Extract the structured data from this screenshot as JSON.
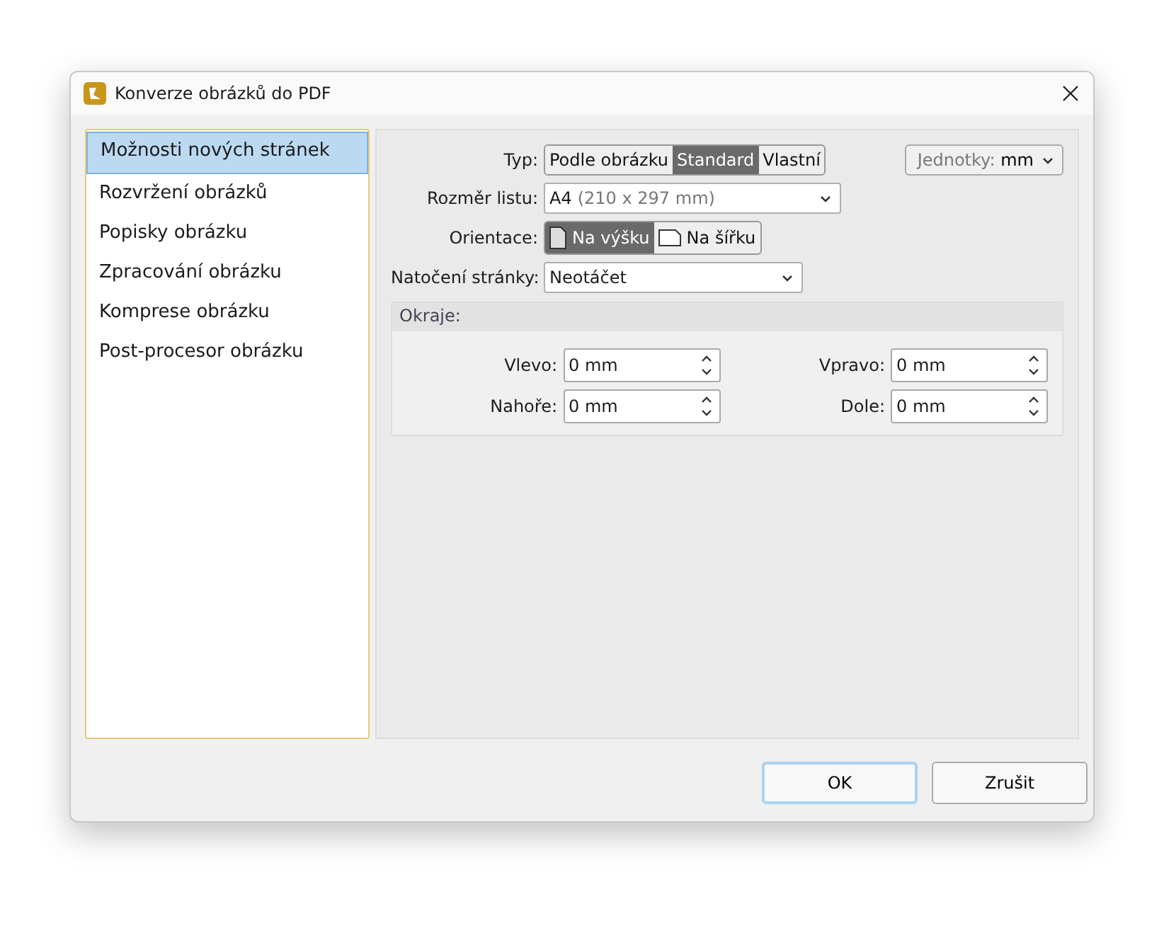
{
  "window": {
    "title": "Konverze obrázků do PDF"
  },
  "sidebar": {
    "items": [
      {
        "label": "Možnosti nových stránek",
        "selected": true
      },
      {
        "label": "Rozvržení obrázků",
        "selected": false
      },
      {
        "label": "Popisky obrázku",
        "selected": false
      },
      {
        "label": "Zpracování obrázku",
        "selected": false
      },
      {
        "label": "Komprese obrázku",
        "selected": false
      },
      {
        "label": "Post-procesor obrázku",
        "selected": false
      }
    ]
  },
  "form": {
    "type": {
      "label": "Typ:",
      "options": [
        {
          "label": "Podle obrázku",
          "selected": false
        },
        {
          "label": "Standard",
          "selected": true
        },
        {
          "label": "Vlastní",
          "selected": false
        }
      ]
    },
    "units": {
      "label": "Jednotky:",
      "value": "mm"
    },
    "sheet_size": {
      "label": "Rozměr listu:",
      "value": "A4",
      "detail": "(210 x 297 mm)"
    },
    "orientation": {
      "label": "Orientace:",
      "options": [
        {
          "label": "Na výšku",
          "selected": true
        },
        {
          "label": "Na šířku",
          "selected": false
        }
      ]
    },
    "rotation": {
      "label": "Natočení stránky:",
      "value": "Neotáčet"
    },
    "margins": {
      "title": "Okraje:",
      "fields": [
        {
          "label": "Vlevo:",
          "value": "0 mm"
        },
        {
          "label": "Vpravo:",
          "value": "0 mm"
        },
        {
          "label": "Nahoře:",
          "value": "0 mm"
        },
        {
          "label": "Dole:",
          "value": "0 mm"
        }
      ]
    }
  },
  "buttons": [
    {
      "label": "OK",
      "default": true
    },
    {
      "label": "Zrušit",
      "default": false
    }
  ]
}
